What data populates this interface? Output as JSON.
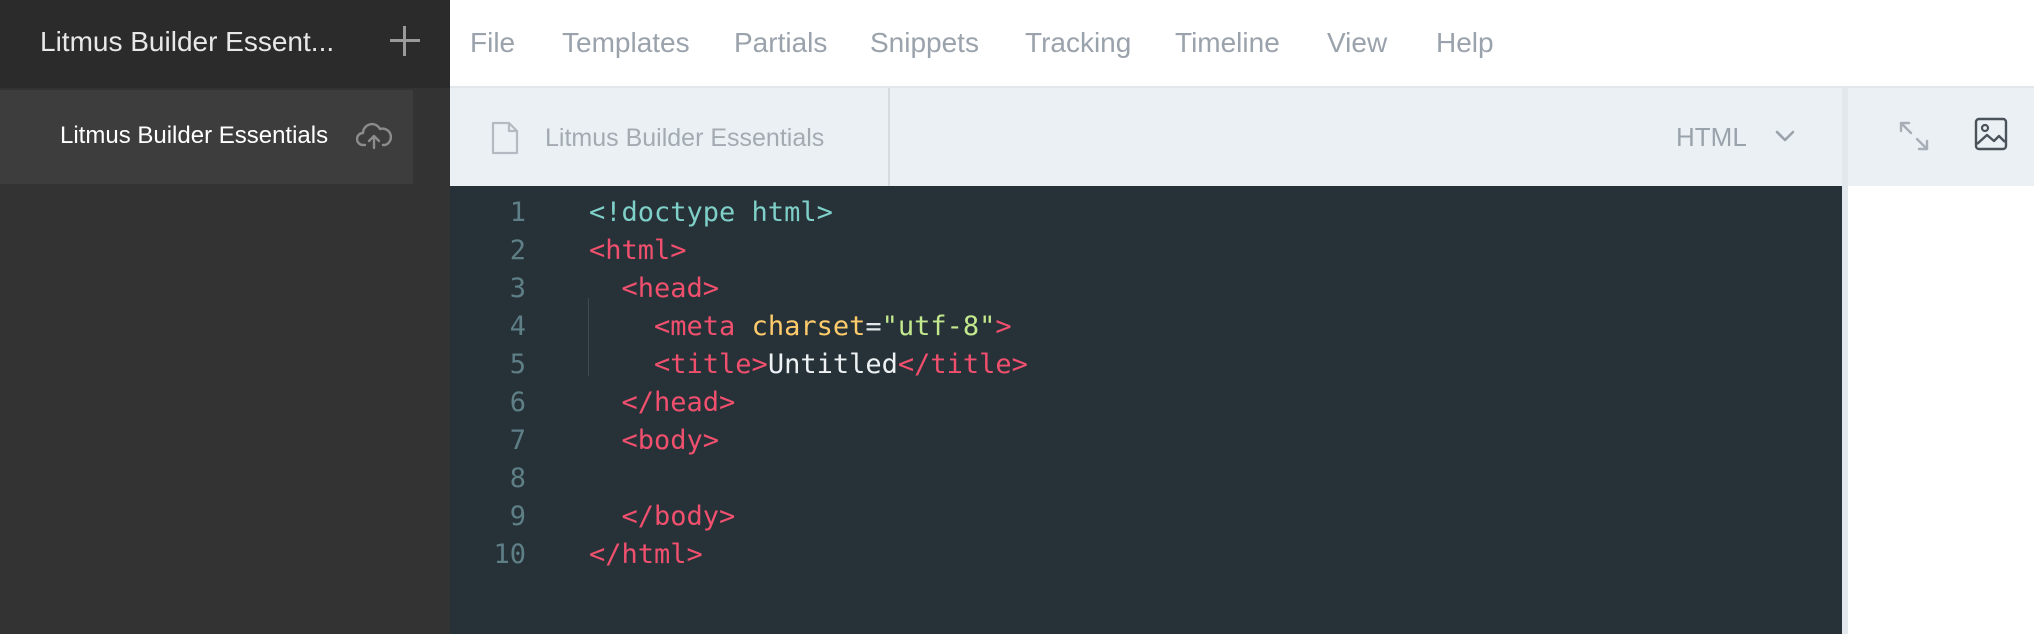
{
  "sidebar": {
    "title": "Litmus Builder Essent...",
    "add_icon": "plus-icon",
    "projects": [
      {
        "label": "Litmus Builder Essentials",
        "icon": "cloud-upload-icon"
      }
    ]
  },
  "menu": {
    "items": [
      "File",
      "Templates",
      "Partials",
      "Snippets",
      "Tracking",
      "Timeline",
      "View",
      "Help"
    ]
  },
  "editor": {
    "file_name": "Litmus Builder Essentials",
    "language": "HTML",
    "lines": [
      {
        "num": "1",
        "tokens": [
          {
            "t": "doctype",
            "v": "<!doctype html>"
          }
        ]
      },
      {
        "num": "2",
        "tokens": [
          {
            "t": "tag",
            "v": "<html>"
          }
        ]
      },
      {
        "num": "3",
        "tokens": [
          {
            "t": "tag",
            "v": "  <head>"
          }
        ]
      },
      {
        "num": "4",
        "tokens": [
          {
            "t": "tag",
            "v": "    <meta "
          },
          {
            "t": "attr",
            "v": "charset"
          },
          {
            "t": "eq",
            "v": "="
          },
          {
            "t": "str",
            "v": "\"utf-8\""
          },
          {
            "t": "tag",
            "v": ">"
          }
        ]
      },
      {
        "num": "5",
        "tokens": [
          {
            "t": "tag",
            "v": "    <title>"
          },
          {
            "t": "text",
            "v": "Untitled"
          },
          {
            "t": "tag",
            "v": "</title>"
          }
        ]
      },
      {
        "num": "6",
        "tokens": [
          {
            "t": "tag",
            "v": "  </head>"
          }
        ]
      },
      {
        "num": "7",
        "tokens": [
          {
            "t": "tag",
            "v": "  <body>"
          }
        ]
      },
      {
        "num": "8",
        "tokens": []
      },
      {
        "num": "9",
        "tokens": [
          {
            "t": "tag",
            "v": "  </body>"
          }
        ]
      },
      {
        "num": "10",
        "tokens": [
          {
            "t": "tag",
            "v": "</html>"
          }
        ]
      }
    ]
  },
  "preview_toolbar": {
    "icons": [
      "expand-icon",
      "image-icon"
    ]
  },
  "colors": {
    "editor_bg": "#263238",
    "tag": "#f0506e",
    "attr": "#ffcb6b",
    "string": "#c3e88d",
    "doctype": "#7fd0c8"
  }
}
